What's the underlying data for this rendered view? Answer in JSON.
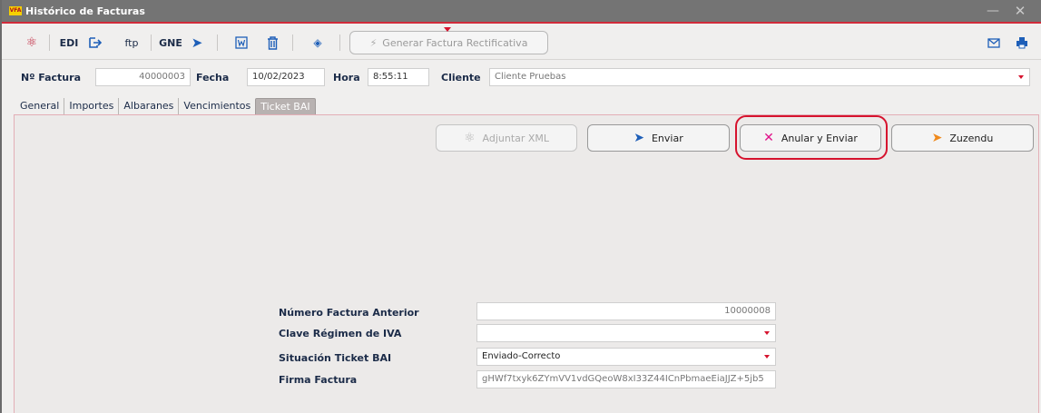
{
  "window": {
    "logo_text": "VFA",
    "title": "Histórico de Facturas",
    "minimize_glyph": "—",
    "close_glyph": "✕"
  },
  "toolbar": {
    "edi_label": "EDI",
    "ftp_label": "ftp",
    "gne_label": "GNE",
    "generar_label": "Generar Factura Rectificativa"
  },
  "header": {
    "factura_label": "Nº Factura",
    "factura_value": "40000003",
    "fecha_label": "Fecha",
    "fecha_value": "10/02/2023",
    "hora_label": "Hora",
    "hora_value": "8:55:11",
    "cliente_label": "Cliente",
    "cliente_value": "Cliente Pruebas"
  },
  "tabs": [
    {
      "label": "General"
    },
    {
      "label": "Importes"
    },
    {
      "label": "Albaranes"
    },
    {
      "label": "Vencimientos"
    },
    {
      "label": "Ticket BAI"
    }
  ],
  "actions": {
    "adjuntar_label": "Adjuntar XML",
    "enviar_label": "Enviar",
    "anular_label": "Anular y Enviar",
    "zuzendu_label": "Zuzendu"
  },
  "form": {
    "numero_label": "Número Factura Anterior",
    "numero_value": "10000008",
    "clave_label": "Clave Régimen de IVA",
    "clave_value": "",
    "situacion_label": "Situación Ticket BAI",
    "situacion_value": "Enviado-Correcto",
    "firma_label": "Firma Factura",
    "firma_value": "gHWf7txyk6ZYmVV1vdGQeoW8xI33Z44ICnPbmaeEiaJJZ+5jb5"
  },
  "colors": {
    "accent_red": "#d6132e",
    "accent_blue": "#1e5fb8",
    "accent_pink": "#e0138a",
    "accent_orange": "#f08a1c",
    "titlebar": "#747474"
  }
}
